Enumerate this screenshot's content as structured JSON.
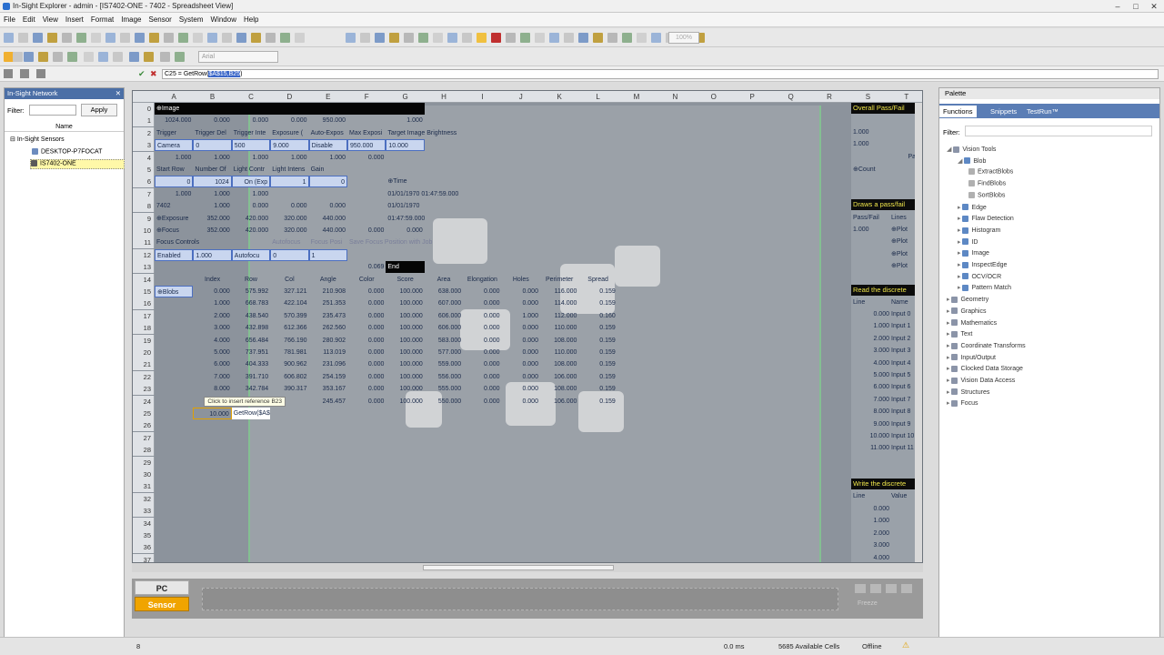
{
  "window": {
    "title": "In-Sight Explorer - admin - [IS7402-ONE - 7402 - Spreadsheet View]"
  },
  "menu": [
    "File",
    "Edit",
    "View",
    "Insert",
    "Format",
    "Image",
    "Sensor",
    "System",
    "Window",
    "Help"
  ],
  "toolbar": {
    "font_name": "Arial",
    "zoom": "100%"
  },
  "formula_bar": {
    "cell_ref": "C25",
    "prefix": "= GetRow(",
    "highlight": "$A$15,B25",
    "suffix": ")"
  },
  "network_panel": {
    "title": "In-Sight Network",
    "filter_label": "Filter:",
    "filter_value": "",
    "apply_label": "Apply",
    "name_header": "Name",
    "tree": [
      "In-Sight Sensors",
      "DESKTOP-P7FOCAT",
      "IS7402-ONE"
    ]
  },
  "sheet": {
    "columns": [
      "A",
      "B",
      "C",
      "D",
      "E",
      "F",
      "G",
      "H",
      "I",
      "J",
      "K",
      "L",
      "M",
      "N",
      "O",
      "P",
      "Q",
      "R",
      "S",
      "T"
    ],
    "rows": [
      "0",
      "1",
      "2",
      "3",
      "4",
      "5",
      "6",
      "7",
      "8",
      "9",
      "10",
      "11",
      "12",
      "13",
      "14",
      "15",
      "16",
      "17",
      "18",
      "19",
      "20",
      "21",
      "22",
      "23",
      "24",
      "25",
      "26",
      "27",
      "28",
      "29",
      "30",
      "31",
      "32",
      "33",
      "34",
      "35",
      "36",
      "37"
    ],
    "top_cells": {
      "r0_image": "Image",
      "r1": [
        "1024.000",
        "0.000",
        "0.000",
        "0.000",
        "950.000",
        "1.000"
      ],
      "r2": [
        "Trigger",
        "Trigger Del",
        "Trigger Inte",
        "Exposure (",
        "Auto-Expos",
        "Max Exposi",
        "Target Image Brightness"
      ],
      "r3": [
        "Camera",
        "0",
        "500",
        "9.000",
        "Disable",
        "950.000",
        "10.000"
      ],
      "r4": [
        "1.000",
        "1.000",
        "1.000",
        "1.000",
        "1.000",
        "0.000"
      ],
      "r5": [
        "Start Row",
        "Number Of",
        "Light Contr",
        "Light Intens",
        "Gain"
      ],
      "r6": [
        "0",
        "1024",
        "On (Exp",
        "1",
        "0",
        "Time"
      ],
      "r7": [
        "1.000",
        "1.000",
        "1.000",
        "01/01/1970 01:47:59.000"
      ],
      "r8": [
        "7402",
        "1.000",
        "0.000",
        "0.000",
        "0.000",
        "01/01/1970"
      ],
      "r9": [
        "Exposure",
        "352.000",
        "420.000",
        "320.000",
        "440.000",
        "01:47:59.000"
      ],
      "r10": [
        "Focus",
        "352.000",
        "420.000",
        "320.000",
        "440.000",
        "0.000",
        "0.000"
      ],
      "r11": [
        "Focus Controls",
        "Autofocus",
        "Focus Posi",
        "Save Focus Position with Job"
      ],
      "r12": [
        "Enabled",
        "1.000",
        "Autofocu",
        "0",
        "1"
      ],
      "r13": [
        "0.069",
        "End"
      ]
    },
    "blob_headers": [
      "Index",
      "Row",
      "Col",
      "Angle",
      "Color",
      "Score",
      "Area",
      "Elongation",
      "Holes",
      "Perimeter",
      "Spread"
    ],
    "blob_label": "Blobs",
    "blob_rows": [
      [
        "0.000",
        "575.992",
        "327.121",
        "210.908",
        "0.000",
        "100.000",
        "638.000",
        "0.000",
        "0.000",
        "116.000",
        "0.159"
      ],
      [
        "1.000",
        "668.783",
        "422.104",
        "251.353",
        "0.000",
        "100.000",
        "607.000",
        "0.000",
        "0.000",
        "114.000",
        "0.159"
      ],
      [
        "2.000",
        "438.540",
        "570.399",
        "235.473",
        "0.000",
        "100.000",
        "606.000",
        "0.000",
        "1.000",
        "112.000",
        "0.160"
      ],
      [
        "3.000",
        "432.898",
        "612.366",
        "262.560",
        "0.000",
        "100.000",
        "606.000",
        "0.000",
        "0.000",
        "110.000",
        "0.159"
      ],
      [
        "4.000",
        "656.484",
        "766.190",
        "280.902",
        "0.000",
        "100.000",
        "583.000",
        "0.000",
        "0.000",
        "108.000",
        "0.159"
      ],
      [
        "5.000",
        "737.951",
        "781.981",
        "113.019",
        "0.000",
        "100.000",
        "577.000",
        "0.000",
        "0.000",
        "110.000",
        "0.159"
      ],
      [
        "6.000",
        "404.333",
        "900.962",
        "231.096",
        "0.000",
        "100.000",
        "559.000",
        "0.000",
        "0.000",
        "108.000",
        "0.159"
      ],
      [
        "7.000",
        "391.710",
        "606.802",
        "254.159",
        "0.000",
        "100.000",
        "556.000",
        "0.000",
        "0.000",
        "106.000",
        "0.159"
      ],
      [
        "8.000",
        "342.784",
        "390.317",
        "353.167",
        "0.000",
        "100.000",
        "555.000",
        "0.000",
        "0.000",
        "108.000",
        "0.159"
      ],
      [
        "9.000",
        "",
        "",
        "245.457",
        "0.000",
        "100.000",
        "550.000",
        "0.000",
        "0.000",
        "106.000",
        "0.159"
      ]
    ],
    "row25": [
      "10.000",
      "GetRow($A$"
    ],
    "tooltip": "Click to insert reference B23",
    "right": {
      "overall": "Overall Pass/Fail",
      "overall_vals": [
        "1",
        "1.000",
        "1.000",
        "Pass"
      ],
      "count": "Count",
      "draws": "Draws a pass/fail",
      "draws_sub": [
        "Pass/Fail",
        "Lines"
      ],
      "draws_val": "1.000",
      "plots": [
        "Plot",
        "Plot",
        "Plot",
        "Plot"
      ],
      "read": "Read the discrete",
      "read_hdr": [
        "Line",
        "Name"
      ],
      "read_rows": [
        [
          "0.000",
          "Input 0"
        ],
        [
          "1.000",
          "Input 1"
        ],
        [
          "2.000",
          "Input 2"
        ],
        [
          "3.000",
          "Input 3"
        ],
        [
          "4.000",
          "Input 4"
        ],
        [
          "5.000",
          "Input 5"
        ],
        [
          "6.000",
          "Input 6"
        ],
        [
          "7.000",
          "Input 7"
        ],
        [
          "8.000",
          "Input 8"
        ],
        [
          "9.000",
          "Input 9"
        ],
        [
          "10.000",
          "Input 10"
        ],
        [
          "11.000",
          "Input 11"
        ]
      ],
      "write": "Write the discrete",
      "write_hdr": [
        "Line",
        "Value"
      ],
      "write_rows": [
        "0.000",
        "1.000",
        "2.000",
        "3.000",
        "4.000"
      ]
    }
  },
  "filmstrip": {
    "pc_label": "PC",
    "sensor_label": "Sensor",
    "freeze_label": "Freeze"
  },
  "palette": {
    "title": "Palette",
    "tabs": [
      "Functions",
      "Snippets",
      "TestRun™"
    ],
    "filter_label": "Filter:",
    "tree": [
      {
        "label": "Vision Tools",
        "level": 0,
        "open": true
      },
      {
        "label": "Blob",
        "level": 1,
        "open": true
      },
      {
        "label": "ExtractBlobs",
        "level": 2
      },
      {
        "label": "FindBlobs",
        "level": 2
      },
      {
        "label": "SortBlobs",
        "level": 2
      },
      {
        "label": "Edge",
        "level": 1
      },
      {
        "label": "Flaw Detection",
        "level": 1
      },
      {
        "label": "Histogram",
        "level": 1
      },
      {
        "label": "ID",
        "level": 1
      },
      {
        "label": "Image",
        "level": 1
      },
      {
        "label": "InspectEdge",
        "level": 1
      },
      {
        "label": "OCV/OCR",
        "level": 1
      },
      {
        "label": "Pattern Match",
        "level": 1
      },
      {
        "label": "Geometry",
        "level": 0
      },
      {
        "label": "Graphics",
        "level": 0
      },
      {
        "label": "Mathematics",
        "level": 0
      },
      {
        "label": "Text",
        "level": 0
      },
      {
        "label": "Coordinate Transforms",
        "level": 0
      },
      {
        "label": "Input/Output",
        "level": 0
      },
      {
        "label": "Clocked Data Storage",
        "level": 0
      },
      {
        "label": "Vision Data Access",
        "level": 0
      },
      {
        "label": "Structures",
        "level": 0
      },
      {
        "label": "Focus",
        "level": 0
      }
    ]
  },
  "status": {
    "left": "8",
    "time": "0.0 ms",
    "cells": "5685 Available Cells",
    "mode": "Offline"
  },
  "colors": {
    "accent": "#4b6fa6",
    "sensor_btn": "#f0a400",
    "green_border": "#7fe38a"
  }
}
